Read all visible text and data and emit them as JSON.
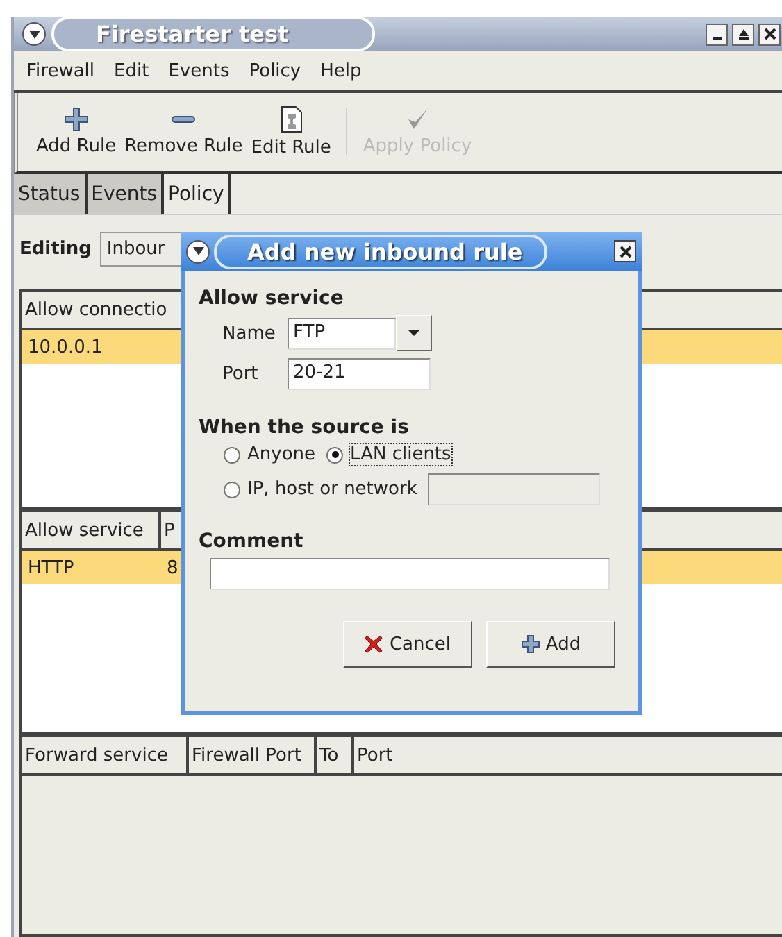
{
  "window": {
    "title": "Firestarter test"
  },
  "menu": [
    "Firewall",
    "Edit",
    "Events",
    "Policy",
    "Help"
  ],
  "toolbar": [
    {
      "label": "Add Rule",
      "kind": "plus",
      "disabled": false
    },
    {
      "label": "Remove Rule",
      "kind": "minus",
      "disabled": false
    },
    {
      "label": "Edit Rule",
      "kind": "edit",
      "disabled": false
    },
    {
      "label": "Apply Policy",
      "kind": "check",
      "disabled": true
    }
  ],
  "tabs": [
    {
      "label": "Status",
      "selected": false
    },
    {
      "label": "Events",
      "selected": false
    },
    {
      "label": "Policy",
      "selected": true
    }
  ],
  "editing": {
    "label": "Editing",
    "value": "Inbour"
  },
  "tables": [
    {
      "columns": [
        "Allow connectio"
      ],
      "rows": [
        {
          "cells": [
            "10.0.0.1"
          ],
          "selected": true
        }
      ]
    },
    {
      "columns": [
        "Allow service",
        "P"
      ],
      "rows": [
        {
          "cells": [
            "HTTP",
            "8"
          ],
          "selected": true
        }
      ]
    },
    {
      "columns": [
        "Forward service",
        "Firewall Port",
        "To",
        "Port"
      ]
    }
  ],
  "dialog": {
    "title": "Add new inbound rule",
    "service_heading": "Allow service",
    "name_label": "Name",
    "name_value": "FTP",
    "port_label": "Port",
    "port_value": "20-21",
    "source_heading": "When the source is",
    "sources": [
      {
        "label": "Anyone",
        "selected": false
      },
      {
        "label": "LAN clients",
        "selected": true
      },
      {
        "label": "IP, host or network",
        "selected": false,
        "field_disabled": true
      }
    ],
    "comment_heading": "Comment",
    "buttons": [
      {
        "label": "Cancel",
        "kind": "cancel"
      },
      {
        "label": "Add",
        "kind": "add"
      }
    ]
  }
}
